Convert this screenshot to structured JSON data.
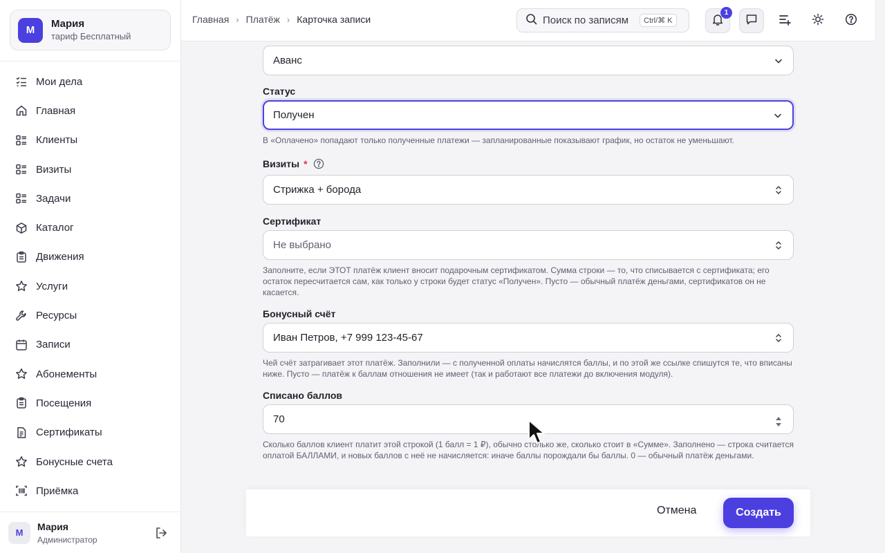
{
  "account": {
    "initial": "М",
    "name": "Мария",
    "plan": "тариф Бесплатный"
  },
  "sidebar": {
    "items": [
      {
        "label": "Мои дела",
        "icon": "checklist-icon"
      },
      {
        "label": "Главная",
        "icon": "home-icon"
      },
      {
        "label": "Клиенты",
        "icon": "list-icon"
      },
      {
        "label": "Визиты",
        "icon": "list-icon"
      },
      {
        "label": "Задачи",
        "icon": "list-icon"
      },
      {
        "label": "Каталог",
        "icon": "box-icon"
      },
      {
        "label": "Движения",
        "icon": "clipboard-icon"
      },
      {
        "label": "Услуги",
        "icon": "star-icon"
      },
      {
        "label": "Ресурсы",
        "icon": "wrench-icon"
      },
      {
        "label": "Записи",
        "icon": "calendar-icon"
      },
      {
        "label": "Абонементы",
        "icon": "star-icon"
      },
      {
        "label": "Посещения",
        "icon": "clipboard-icon"
      },
      {
        "label": "Сертификаты",
        "icon": "document-icon"
      },
      {
        "label": "Бонусные счета",
        "icon": "star-icon"
      },
      {
        "label": "Приёмка",
        "icon": "barcode-icon"
      }
    ]
  },
  "user": {
    "initial": "М",
    "name": "Мария",
    "role": "Администратор"
  },
  "header": {
    "breadcrumb": [
      "Главная",
      "Платёж",
      "Карточка записи"
    ],
    "search_placeholder": "Поиск по записям",
    "search_shortcut": "Ctrl/⌘ K",
    "notifications_count": "1"
  },
  "form": {
    "type_value": "Аванс",
    "status": {
      "label": "Статус",
      "value": "Получен",
      "hint": "В «Оплачено» попадают только полученные платежи — запланированные показывают график, но остаток не уменьшают."
    },
    "visits": {
      "label": "Визиты",
      "required_mark": "*",
      "value": "Стрижка + борода"
    },
    "certificate": {
      "label": "Сертификат",
      "value": "Не выбрано",
      "hint": "Заполните, если ЭТОТ платёж клиент вносит подарочным сертификатом. Сумма строки — то, что списывается с сертификата; его остаток пересчитается сам, как только у строки будет статус «Получен». Пусто — обычный платёж деньгами, сертификатов он не касается."
    },
    "bonus_account": {
      "label": "Бонусный счёт",
      "value": "Иван Петров, +7 999 123-45-67",
      "hint": "Чей счёт затрагивает этот платёж. Заполнили — с полученной оплаты начислятся баллы, и по этой же ссылке спишутся те, что вписаны ниже. Пусто — платёж к баллам отношения не имеет (так и работают все платежи до включения модуля)."
    },
    "points": {
      "label": "Списано баллов",
      "value": "70",
      "hint": "Сколько баллов клиент платит этой строкой (1 балл = 1 ₽), обычно столько же, сколько стоит в «Сумме». Заполнено — строка считается оплатой БАЛЛАМИ, и новых баллов с неё не начисляется: иначе баллы порождали бы баллы. 0 — обычный платёж деньгами."
    }
  },
  "actions": {
    "cancel": "Отмена",
    "create": "Создать"
  },
  "colors": {
    "accent": "#4b3fe0",
    "required": "#e0353f"
  }
}
